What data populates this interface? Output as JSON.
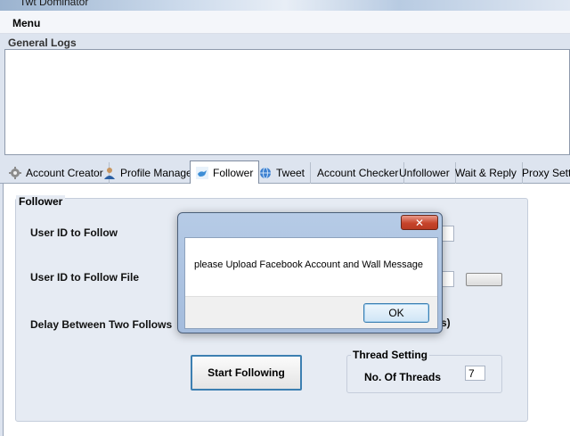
{
  "window": {
    "title": "Twt Dominator"
  },
  "menubar": {
    "menu_label": "Menu"
  },
  "logs": {
    "label": "General Logs",
    "content": ""
  },
  "tabs": [
    {
      "label": "Account Creator",
      "icon": "gear-icon"
    },
    {
      "label": "Profile Manager",
      "icon": "user-icon"
    },
    {
      "label": "Follower",
      "icon": "twitter-bird-icon",
      "active": true
    },
    {
      "label": "Tweet",
      "icon": "globe-icon"
    },
    {
      "label": "Account Checker"
    },
    {
      "label": "Unfollower"
    },
    {
      "label": "Wait & Reply"
    },
    {
      "label": "Proxy Setting"
    }
  ],
  "follower": {
    "group_title": "Follower",
    "user_id_label": "User ID to Follow",
    "user_id_file_label": "User ID to Follow File",
    "delay_label": "Delay Between Two Follows",
    "delay_suffix": "s)",
    "start_button": "Start Following",
    "thread_setting_title": "Thread Setting",
    "threads_label": "No. Of Threads",
    "threads_value": "7"
  },
  "dialog": {
    "close_glyph": "✕",
    "message": "please Upload Facebook Account and Wall Message",
    "ok_label": "OK"
  }
}
